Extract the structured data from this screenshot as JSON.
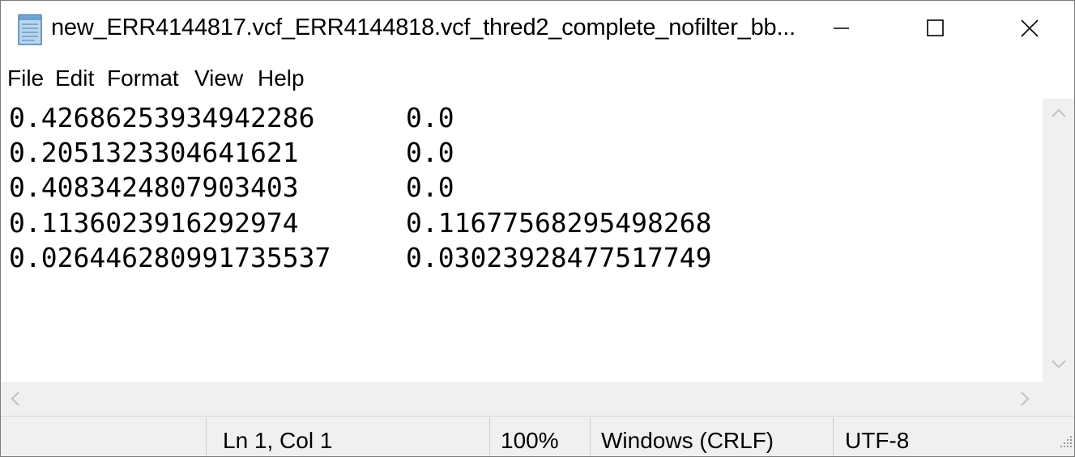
{
  "window": {
    "title": "new_ERR4144817.vcf_ERR4144818.vcf_thred2_complete_nofilter_bb...",
    "icon": "notepad-icon"
  },
  "controls": {
    "minimize": "minimize-icon",
    "maximize": "maximize-icon",
    "close": "close-icon"
  },
  "menu": [
    "File",
    "Edit",
    "Format",
    "View",
    "Help"
  ],
  "content": {
    "lines": [
      [
        "0.42686253934942286",
        "0.0"
      ],
      [
        "0.2051323304641621",
        "0.0"
      ],
      [
        "0.4083424807903403",
        "0.0"
      ],
      [
        "0.1136023916292974",
        "0.11677568295498268"
      ],
      [
        "0.026446280991735537",
        "0.03023928477517749"
      ]
    ]
  },
  "status": {
    "position": "Ln 1, Col 1",
    "zoom": "100%",
    "line_endings": "Windows (CRLF)",
    "encoding": "UTF-8"
  },
  "colors": {
    "chrome": "#f0f0f0",
    "scroll_arrow": "#c2c2c2",
    "text": "#000000"
  }
}
